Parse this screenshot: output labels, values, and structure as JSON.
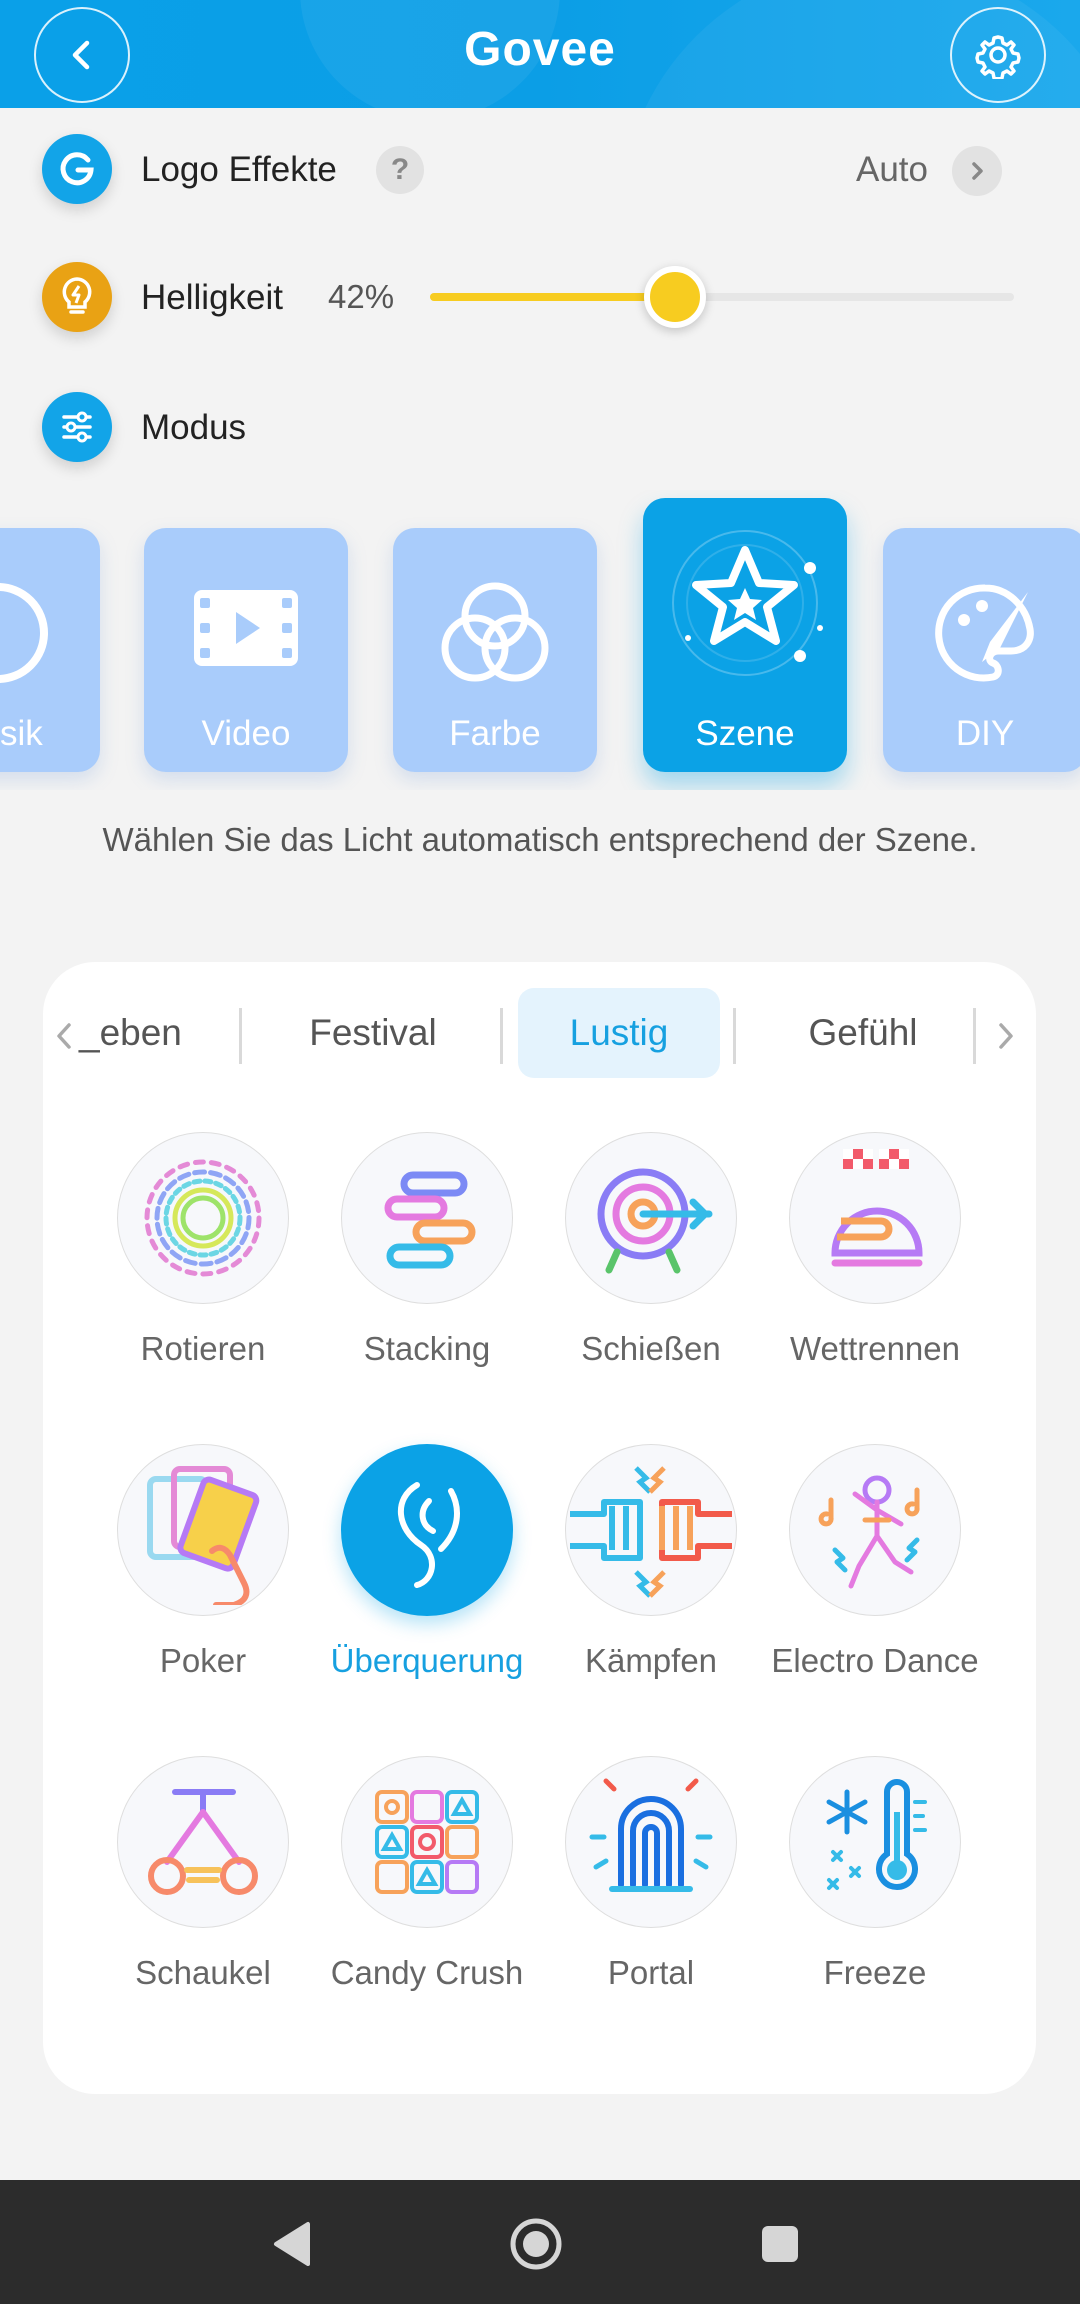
{
  "header": {
    "brand": "Govee"
  },
  "rows": {
    "logo_effects": {
      "label": "Logo Effekte",
      "help": "?",
      "value": "Auto"
    },
    "brightness": {
      "label": "Helligkeit",
      "value_text": "42%",
      "level": 0.42
    },
    "mode": {
      "label": "Modus"
    }
  },
  "modes": [
    {
      "label": "sik",
      "icon": "music-icon",
      "active": false
    },
    {
      "label": "Video",
      "icon": "video-icon",
      "active": false
    },
    {
      "label": "Farbe",
      "icon": "color-circles-icon",
      "active": false
    },
    {
      "label": "Szene",
      "icon": "star-scene-icon",
      "active": true
    },
    {
      "label": "DIY",
      "icon": "palette-brush-icon",
      "active": false
    }
  ],
  "description": "Wählen Sie das Licht automatisch entsprechend der Szene.",
  "tabs": [
    {
      "label": "_eben",
      "active": false
    },
    {
      "label": "Festival",
      "active": false
    },
    {
      "label": "Lustig",
      "active": true
    },
    {
      "label": "Gefühl",
      "active": false
    }
  ],
  "scenes": [
    {
      "label": "Rotieren",
      "icon": "rotate-icon",
      "selected": false
    },
    {
      "label": "Stacking",
      "icon": "stacking-icon",
      "selected": false
    },
    {
      "label": "Schießen",
      "icon": "target-icon",
      "selected": false
    },
    {
      "label": "Wettrennen",
      "icon": "racing-helmet-icon",
      "selected": false
    },
    {
      "label": "Poker",
      "icon": "cards-icon",
      "selected": false
    },
    {
      "label": "Überquerung",
      "icon": "crossing-icon",
      "selected": true
    },
    {
      "label": "Kämpfen",
      "icon": "fists-icon",
      "selected": false
    },
    {
      "label": "Electro Dance",
      "icon": "dancer-icon",
      "selected": false
    },
    {
      "label": "Schaukel",
      "icon": "swing-icon",
      "selected": false
    },
    {
      "label": "Candy Crush",
      "icon": "candy-grid-icon",
      "selected": false
    },
    {
      "label": "Portal",
      "icon": "portal-icon",
      "selected": false
    },
    {
      "label": "Freeze",
      "icon": "snowflake-thermometer-icon",
      "selected": false
    }
  ],
  "colors": {
    "primary": "#0ba2e6",
    "mode_inactive": "#a9ccfb",
    "brightness": "#f7cc20",
    "bulb_icon": "#e9a214"
  }
}
